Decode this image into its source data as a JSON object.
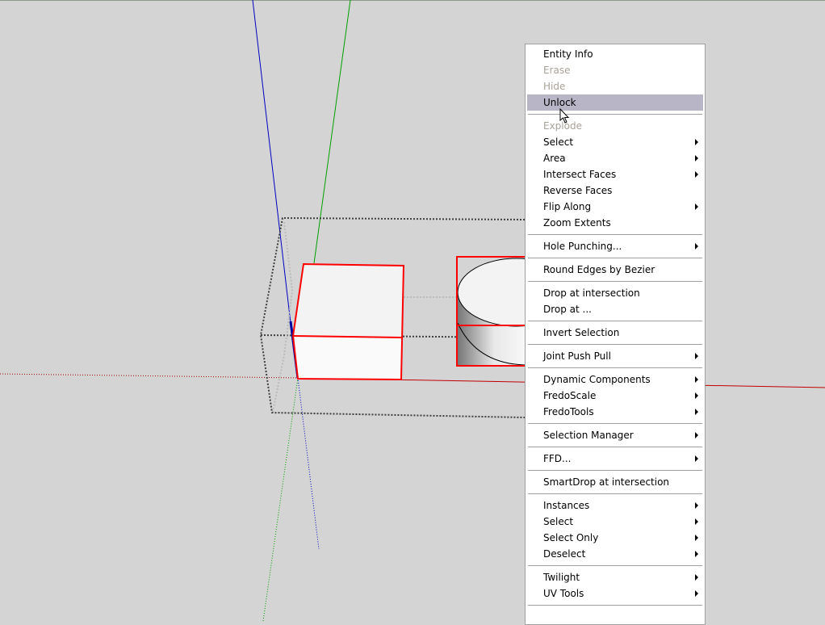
{
  "colors": {
    "background": "#d4d4d4",
    "selection": "#ff0000",
    "x_axis": "#c00000",
    "y_axis": "#00a000",
    "z_axis": "#0000c0",
    "highlight": "#b8b6c6"
  },
  "context_menu": {
    "items": [
      {
        "label": "Entity Info"
      },
      {
        "label": "Erase",
        "disabled": true
      },
      {
        "label": "Hide",
        "disabled": true
      },
      {
        "label": "Unlock",
        "highlighted": true
      },
      {
        "separator": true
      },
      {
        "label": "Explode",
        "disabled": true
      },
      {
        "label": "Select",
        "submenu": true
      },
      {
        "label": "Area",
        "submenu": true
      },
      {
        "label": "Intersect Faces",
        "submenu": true
      },
      {
        "label": "Reverse Faces"
      },
      {
        "label": "Flip Along",
        "submenu": true
      },
      {
        "label": "Zoom Extents"
      },
      {
        "separator": true
      },
      {
        "label": "Hole Punching...",
        "submenu": true
      },
      {
        "separator": true
      },
      {
        "label": "Round Edges by Bezier"
      },
      {
        "separator": true
      },
      {
        "label": "Drop at intersection"
      },
      {
        "label": "Drop at ..."
      },
      {
        "separator": true
      },
      {
        "label": "Invert Selection"
      },
      {
        "separator": true
      },
      {
        "label": "Joint Push Pull",
        "submenu": true
      },
      {
        "separator": true
      },
      {
        "label": "Dynamic Components",
        "submenu": true
      },
      {
        "label": "FredoScale",
        "submenu": true
      },
      {
        "label": "FredoTools",
        "submenu": true
      },
      {
        "separator": true
      },
      {
        "label": "Selection Manager",
        "submenu": true
      },
      {
        "separator": true
      },
      {
        "label": "FFD...",
        "submenu": true
      },
      {
        "separator": true
      },
      {
        "label": "SmartDrop at intersection"
      },
      {
        "separator": true
      },
      {
        "label": "Instances",
        "submenu": true
      },
      {
        "label": "Select",
        "submenu": true
      },
      {
        "label": "Select Only",
        "submenu": true
      },
      {
        "label": "Deselect",
        "submenu": true
      },
      {
        "separator": true
      },
      {
        "label": "Twilight",
        "submenu": true
      },
      {
        "label": "UV Tools",
        "submenu": true
      },
      {
        "separator": true
      }
    ]
  }
}
